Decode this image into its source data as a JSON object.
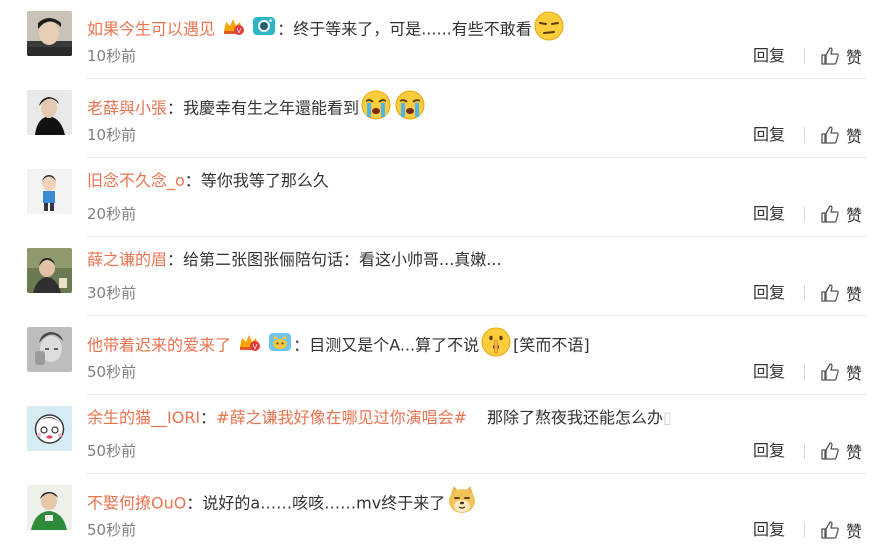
{
  "reply_label": "回复",
  "like_label": "赞",
  "colors": {
    "username": "#eb7350",
    "text": "#333333",
    "time": "#808080"
  },
  "comments": [
    {
      "user": "如果今生可以遇见",
      "icons": [
        "crown-vip-icon",
        "camera-icon"
      ],
      "colon": "：",
      "text": "终于等来了，可是......有些不敢看",
      "emoji": [
        "squint-face-emoji"
      ],
      "time": "10秒前"
    },
    {
      "user": "老薛與小張",
      "colon": "：",
      "text": "我慶幸有生之年還能看到",
      "emoji": [
        "crying-face-emoji",
        "crying-face-emoji"
      ],
      "time": "10秒前"
    },
    {
      "user": "旧念不久念_o",
      "colon": "：",
      "text": "等你我等了那么久",
      "time": "20秒前"
    },
    {
      "user": "薛之谦的眉",
      "colon": "：",
      "text": "给第二张图张俪陪句话：看这小帅哥...真嫩...",
      "time": "30秒前"
    },
    {
      "user": "他带着迟来的爱来了",
      "icons": [
        "crown-vip-icon",
        "cat-badge-icon"
      ],
      "colon": "：",
      "text": "目测又是个A...算了不说",
      "emoji": [
        "shush-face-emoji"
      ],
      "tail": "[笑而不语]",
      "time": "50秒前"
    },
    {
      "user": "余生的猫__IORI",
      "colon": "：",
      "topic": "#薛之谦我好像在哪见过你演唱会#",
      "text": "那除了熬夜我还能怎么办",
      "faded": "​",
      "time": "50秒前"
    },
    {
      "user": "不娶何撩OuO",
      "colon": "：",
      "text": "说好的a……咳咳……mv终于来了",
      "emoji": [
        "doge-emoji"
      ],
      "time": "50秒前"
    }
  ]
}
